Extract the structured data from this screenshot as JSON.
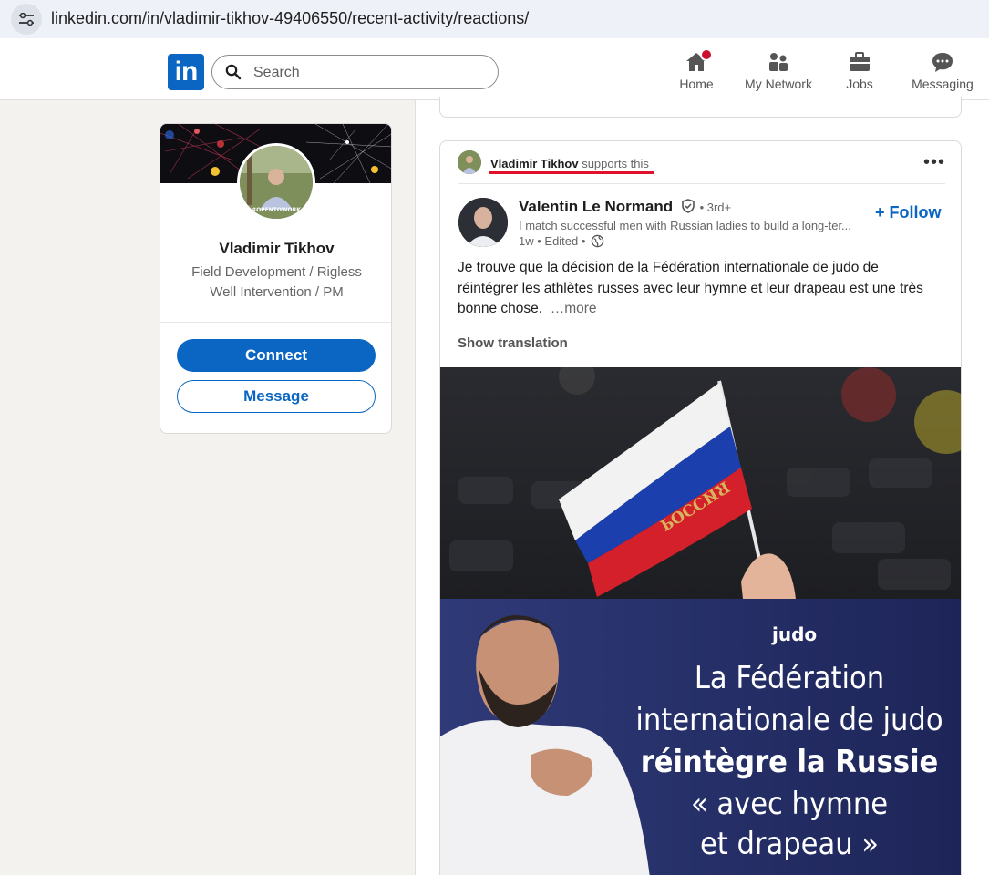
{
  "browser": {
    "url": "linkedin.com/in/vladimir-tikhov-49406550/recent-activity/reactions/",
    "site_info_icon": "tune-icon"
  },
  "nav": {
    "logo_text": "in",
    "search_placeholder": "Search",
    "items": [
      {
        "label": "Home",
        "icon": "home-icon",
        "has_notification": true
      },
      {
        "label": "My Network",
        "icon": "network-icon"
      },
      {
        "label": "Jobs",
        "icon": "briefcase-icon"
      },
      {
        "label": "Messaging",
        "icon": "messaging-icon"
      }
    ],
    "colors": {
      "brand": "#0a66c2",
      "notification": "#cb112d"
    }
  },
  "profile": {
    "name": "Vladimir Tikhov",
    "headline": "Field Development / Rigless Well Intervention / PM",
    "badge_text": "#OPENTOWORK",
    "connect_label": "Connect",
    "message_label": "Message"
  },
  "post": {
    "activity": {
      "actor": "Vladimir Tikhov",
      "verb": "supports this"
    },
    "author": {
      "name": "Valentin Le Normand",
      "degree": "• 3rd+",
      "headline": "I match successful men with Russian ladies to build a long-ter...",
      "time": "1w • Edited •",
      "follow_label": "+ Follow"
    },
    "text": "Je trouve que la décision de la Fédération internationale de judo de réintégrer les athlètes russes avec leur hymne et leur drapeau est une très bonne chose.",
    "more_label": "…more",
    "show_translation": "Show translation",
    "image": {
      "flag_text": "РОССИЯ",
      "kicker": "judo",
      "headline_line1": "La Fédération",
      "headline_line2": "internationale de judo",
      "headline_line3": "réintègre la Russie",
      "headline_line4": "« avec hymne",
      "headline_line5": "et drapeau »"
    }
  }
}
